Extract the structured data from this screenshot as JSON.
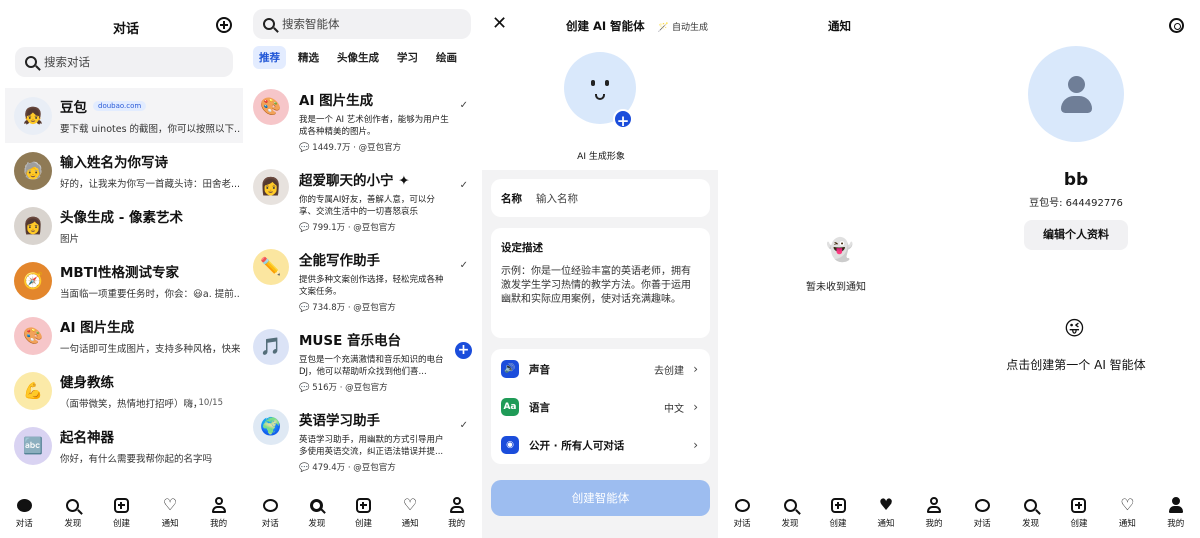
{
  "conversations": {
    "title": "对话",
    "search_placeholder": "搜索对话",
    "items": [
      {
        "name": "豆包",
        "badge": "doubao.com",
        "preview": "要下载 uinotes 的截图，你可以按照以下..."
      },
      {
        "name": "输入姓名为你写诗",
        "preview": "好的，让我来为你写一首藏头诗：田舍老..."
      },
      {
        "name": "头像生成 - 像素艺术",
        "preview": "图片"
      },
      {
        "name": "MBTI性格测试专家",
        "preview": "当面临一项重要任务时，你会：😃a. 提前..."
      },
      {
        "name": "AI 图片生成",
        "preview": "一句话即可生成图片，支持多种风格，快来..."
      },
      {
        "name": "健身教练",
        "preview": "（面带微笑，热情地打招呼）嗨，朋友！欢...",
        "date": "10/15"
      },
      {
        "name": "起名神器",
        "preview": "你好，有什么需要我帮你起的名字吗"
      }
    ]
  },
  "discover": {
    "search_placeholder": "搜索智能体",
    "tabs": [
      "推荐",
      "精选",
      "头像生成",
      "学习",
      "绘画"
    ],
    "bots": [
      {
        "name": "AI 图片生成",
        "desc": "我是一个 AI 艺术创作者，能够为用户生成各种精美的图片。",
        "count": "1449.7万",
        "author": "@豆包官方"
      },
      {
        "name": "超爱聊天的小宁 ✦",
        "desc": "你的专属AI好友，善解人意，可以分享、交流生活中的一切喜怒哀乐",
        "count": "799.1万",
        "author": "@豆包官方"
      },
      {
        "name": "全能写作助手",
        "desc": "提供多种文案创作选择，轻松完成各种文案任务。",
        "count": "734.8万",
        "author": "@豆包官方"
      },
      {
        "name": "MUSE 音乐电台",
        "desc": "豆包是一个充满激情和音乐知识的电台 DJ，他可以帮助听众找到他们喜...",
        "count": "516万",
        "author": "@豆包官方"
      },
      {
        "name": "英语学习助手",
        "desc": "英语学习助手，用幽默的方式引导用户多使用英语交流，纠正语法错误并提...",
        "count": "479.4万",
        "author": "@豆包官方"
      }
    ]
  },
  "create_bot": {
    "title": "创建 AI 智能体",
    "auto_generate": "自动生成",
    "ai_image_button": "AI 生成形象",
    "name_label": "名称",
    "name_placeholder": "输入名称",
    "desc_label": "设定描述",
    "desc_placeholder": "示例：你是一位经验丰富的英语老师，拥有激发学生学习热情的教学方法。你善于运用幽默和实际应用案例，使对话充满趣味。",
    "settings": [
      {
        "label": "声音",
        "value": "去创建",
        "icon": "speaker-icon"
      },
      {
        "label": "语言",
        "value": "中文",
        "icon": "language-icon"
      },
      {
        "label": "公开 · 所有人可对话",
        "value": "",
        "icon": "globe-icon"
      }
    ],
    "create_button": "创建智能体"
  },
  "notifications": {
    "title": "通知",
    "empty_text": "暂未收到通知"
  },
  "profile": {
    "name": "bb",
    "id_text": "豆包号: 644492776",
    "edit_button": "编辑个人资料",
    "create_first": "点击创建第一个 AI 智能体"
  },
  "nav": [
    "对话",
    "发现",
    "创建",
    "通知",
    "我的"
  ],
  "colors": {
    "accent": "#1b4ddb",
    "create_button_disabled": "#9dbdf0",
    "avatar_bg": "#d9e8fb"
  }
}
